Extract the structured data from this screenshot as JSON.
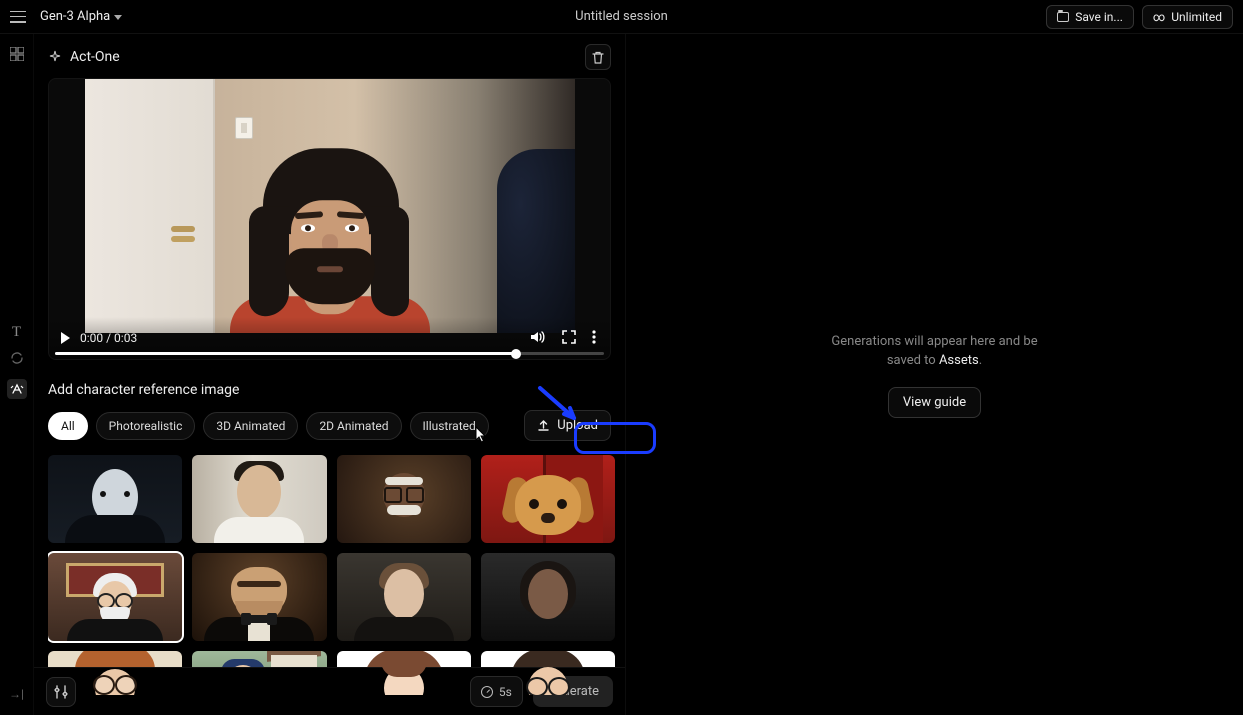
{
  "topbar": {
    "model": "Gen-3 Alpha",
    "session_title": "Untitled session",
    "save_label": "Save in...",
    "plan_label": "Unlimited"
  },
  "tool": {
    "title": "Act-One"
  },
  "video": {
    "current_time": "0:00",
    "duration": "0:03",
    "time_display": "0:00 / 0:03"
  },
  "reference": {
    "section_label": "Add character reference image",
    "filters": {
      "all": "All",
      "photorealistic": "Photorealistic",
      "three_d": "3D Animated",
      "two_d": "2D Animated",
      "illustrated": "Illustrated"
    },
    "upload_label": "Upload"
  },
  "bottom": {
    "duration_label": "5s",
    "generate_label": "Generate"
  },
  "right": {
    "empty_line1": "Generations will appear here and be",
    "empty_line2_prefix": "saved to ",
    "empty_line2_assets": "Assets",
    "empty_line2_suffix": ".",
    "view_guide": "View guide"
  }
}
